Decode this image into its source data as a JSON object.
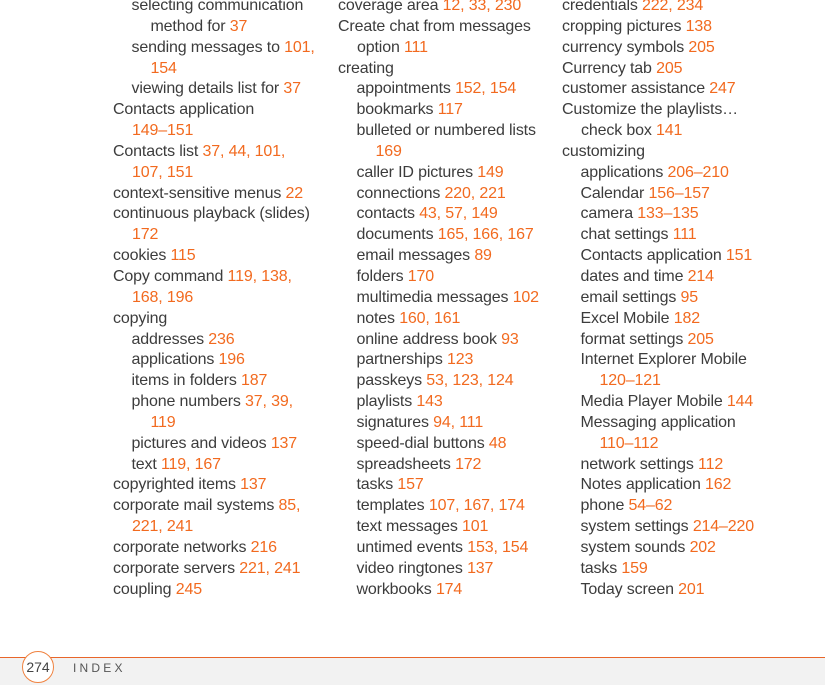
{
  "accent_color": "#f26a1f",
  "columns": [
    [
      {
        "level": 1,
        "text": "selecting communication",
        "pages": ""
      },
      {
        "level": 1,
        "cont": true,
        "text": "method for ",
        "pages": "37"
      },
      {
        "level": 1,
        "text": "sending messages to ",
        "pages": "101,"
      },
      {
        "level": 1,
        "cont": true,
        "text": "",
        "pages": "154"
      },
      {
        "level": 1,
        "text": "viewing details list for ",
        "pages": "37"
      },
      {
        "level": 0,
        "text": "Contacts application",
        "pages": ""
      },
      {
        "level": 0,
        "cont": true,
        "text": "",
        "pages": "149–151"
      },
      {
        "level": 0,
        "text": "Contacts list ",
        "pages": "37, 44, 101,"
      },
      {
        "level": 0,
        "cont": true,
        "text": "",
        "pages": "107, 151"
      },
      {
        "level": 0,
        "text": "context-sensitive menus ",
        "pages": "22"
      },
      {
        "level": 0,
        "text": "continuous playback (slides)",
        "pages": ""
      },
      {
        "level": 0,
        "cont": true,
        "text": "",
        "pages": "172"
      },
      {
        "level": 0,
        "text": "cookies ",
        "pages": "115"
      },
      {
        "level": 0,
        "text": "Copy command ",
        "pages": "119, 138,"
      },
      {
        "level": 0,
        "cont": true,
        "text": "",
        "pages": "168, 196"
      },
      {
        "level": 0,
        "text": "copying",
        "pages": ""
      },
      {
        "level": 1,
        "text": "addresses ",
        "pages": "236"
      },
      {
        "level": 1,
        "text": "applications ",
        "pages": "196"
      },
      {
        "level": 1,
        "text": "items in folders ",
        "pages": "187"
      },
      {
        "level": 1,
        "text": "phone numbers ",
        "pages": "37, 39,"
      },
      {
        "level": 1,
        "cont": true,
        "text": "",
        "pages": "119"
      },
      {
        "level": 1,
        "text": "pictures and videos ",
        "pages": "137"
      },
      {
        "level": 1,
        "text": "text ",
        "pages": "119, 167"
      },
      {
        "level": 0,
        "text": "copyrighted items ",
        "pages": "137"
      },
      {
        "level": 0,
        "text": "corporate mail systems ",
        "pages": "85,"
      },
      {
        "level": 0,
        "cont": true,
        "text": "",
        "pages": "221, 241"
      },
      {
        "level": 0,
        "text": "corporate networks ",
        "pages": "216"
      },
      {
        "level": 0,
        "text": "corporate servers ",
        "pages": "221, 241"
      },
      {
        "level": 0,
        "text": "coupling ",
        "pages": "245"
      }
    ],
    [
      {
        "level": 0,
        "text": "coverage area ",
        "pages": "12, 33, 230"
      },
      {
        "level": 0,
        "text": "Create chat from messages",
        "pages": ""
      },
      {
        "level": 0,
        "cont": true,
        "text": "option ",
        "pages": "111"
      },
      {
        "level": 0,
        "text": "creating",
        "pages": ""
      },
      {
        "level": 1,
        "text": "appointments ",
        "pages": "152, 154"
      },
      {
        "level": 1,
        "text": "bookmarks ",
        "pages": "117"
      },
      {
        "level": 1,
        "text": "bulleted or numbered lists",
        "pages": ""
      },
      {
        "level": 1,
        "cont": true,
        "text": "",
        "pages": "169"
      },
      {
        "level": 1,
        "text": "caller ID pictures ",
        "pages": "149"
      },
      {
        "level": 1,
        "text": "connections ",
        "pages": "220, 221"
      },
      {
        "level": 1,
        "text": "contacts ",
        "pages": "43, 57, 149"
      },
      {
        "level": 1,
        "text": "documents ",
        "pages": "165, 166, 167"
      },
      {
        "level": 1,
        "text": "email messages ",
        "pages": "89"
      },
      {
        "level": 1,
        "text": "folders ",
        "pages": "170"
      },
      {
        "level": 1,
        "text": "multimedia messages ",
        "pages": "102"
      },
      {
        "level": 1,
        "text": "notes ",
        "pages": "160, 161"
      },
      {
        "level": 1,
        "text": "online address book ",
        "pages": "93"
      },
      {
        "level": 1,
        "text": "partnerships ",
        "pages": "123"
      },
      {
        "level": 1,
        "text": "passkeys ",
        "pages": "53, 123, 124"
      },
      {
        "level": 1,
        "text": "playlists ",
        "pages": "143"
      },
      {
        "level": 1,
        "text": "signatures ",
        "pages": "94, 111"
      },
      {
        "level": 1,
        "text": "speed-dial buttons ",
        "pages": "48"
      },
      {
        "level": 1,
        "text": "spreadsheets ",
        "pages": "172"
      },
      {
        "level": 1,
        "text": "tasks ",
        "pages": "157"
      },
      {
        "level": 1,
        "text": "templates ",
        "pages": "107, 167, 174"
      },
      {
        "level": 1,
        "text": "text messages ",
        "pages": "101"
      },
      {
        "level": 1,
        "text": "untimed events ",
        "pages": "153, 154"
      },
      {
        "level": 1,
        "text": "video ringtones ",
        "pages": "137"
      },
      {
        "level": 1,
        "text": "workbooks ",
        "pages": "174"
      }
    ],
    [
      {
        "level": 0,
        "text": "credentials ",
        "pages": "222, 234"
      },
      {
        "level": 0,
        "text": "cropping pictures ",
        "pages": "138"
      },
      {
        "level": 0,
        "text": "currency symbols ",
        "pages": "205"
      },
      {
        "level": 0,
        "text": "Currency tab ",
        "pages": "205"
      },
      {
        "level": 0,
        "text": "customer assistance ",
        "pages": "247"
      },
      {
        "level": 0,
        "text": "Customize the playlists…",
        "pages": ""
      },
      {
        "level": 0,
        "cont": true,
        "text": "check box ",
        "pages": "141"
      },
      {
        "level": 0,
        "text": "customizing",
        "pages": ""
      },
      {
        "level": 1,
        "text": "applications ",
        "pages": "206–210"
      },
      {
        "level": 1,
        "text": "Calendar ",
        "pages": "156–157"
      },
      {
        "level": 1,
        "text": "camera ",
        "pages": "133–135"
      },
      {
        "level": 1,
        "text": "chat settings ",
        "pages": "111"
      },
      {
        "level": 1,
        "text": "Contacts application ",
        "pages": "151"
      },
      {
        "level": 1,
        "text": "dates and time ",
        "pages": "214"
      },
      {
        "level": 1,
        "text": "email settings ",
        "pages": "95"
      },
      {
        "level": 1,
        "text": "Excel Mobile ",
        "pages": "182"
      },
      {
        "level": 1,
        "text": "format settings ",
        "pages": "205"
      },
      {
        "level": 1,
        "text": "Internet Explorer Mobile",
        "pages": ""
      },
      {
        "level": 1,
        "cont": true,
        "text": "",
        "pages": "120–121"
      },
      {
        "level": 1,
        "text": "Media Player Mobile ",
        "pages": "144"
      },
      {
        "level": 1,
        "text": "Messaging application",
        "pages": ""
      },
      {
        "level": 1,
        "cont": true,
        "text": "",
        "pages": "110–112"
      },
      {
        "level": 1,
        "text": "network settings ",
        "pages": "112"
      },
      {
        "level": 1,
        "text": "Notes application ",
        "pages": "162"
      },
      {
        "level": 1,
        "text": "phone ",
        "pages": "54–62"
      },
      {
        "level": 1,
        "text": "system settings ",
        "pages": "214–220"
      },
      {
        "level": 1,
        "text": "system sounds ",
        "pages": "202"
      },
      {
        "level": 1,
        "text": "tasks ",
        "pages": "159"
      },
      {
        "level": 1,
        "text": "Today screen ",
        "pages": "201"
      }
    ]
  ],
  "footer": {
    "page_number": "274",
    "section": "INDEX"
  }
}
